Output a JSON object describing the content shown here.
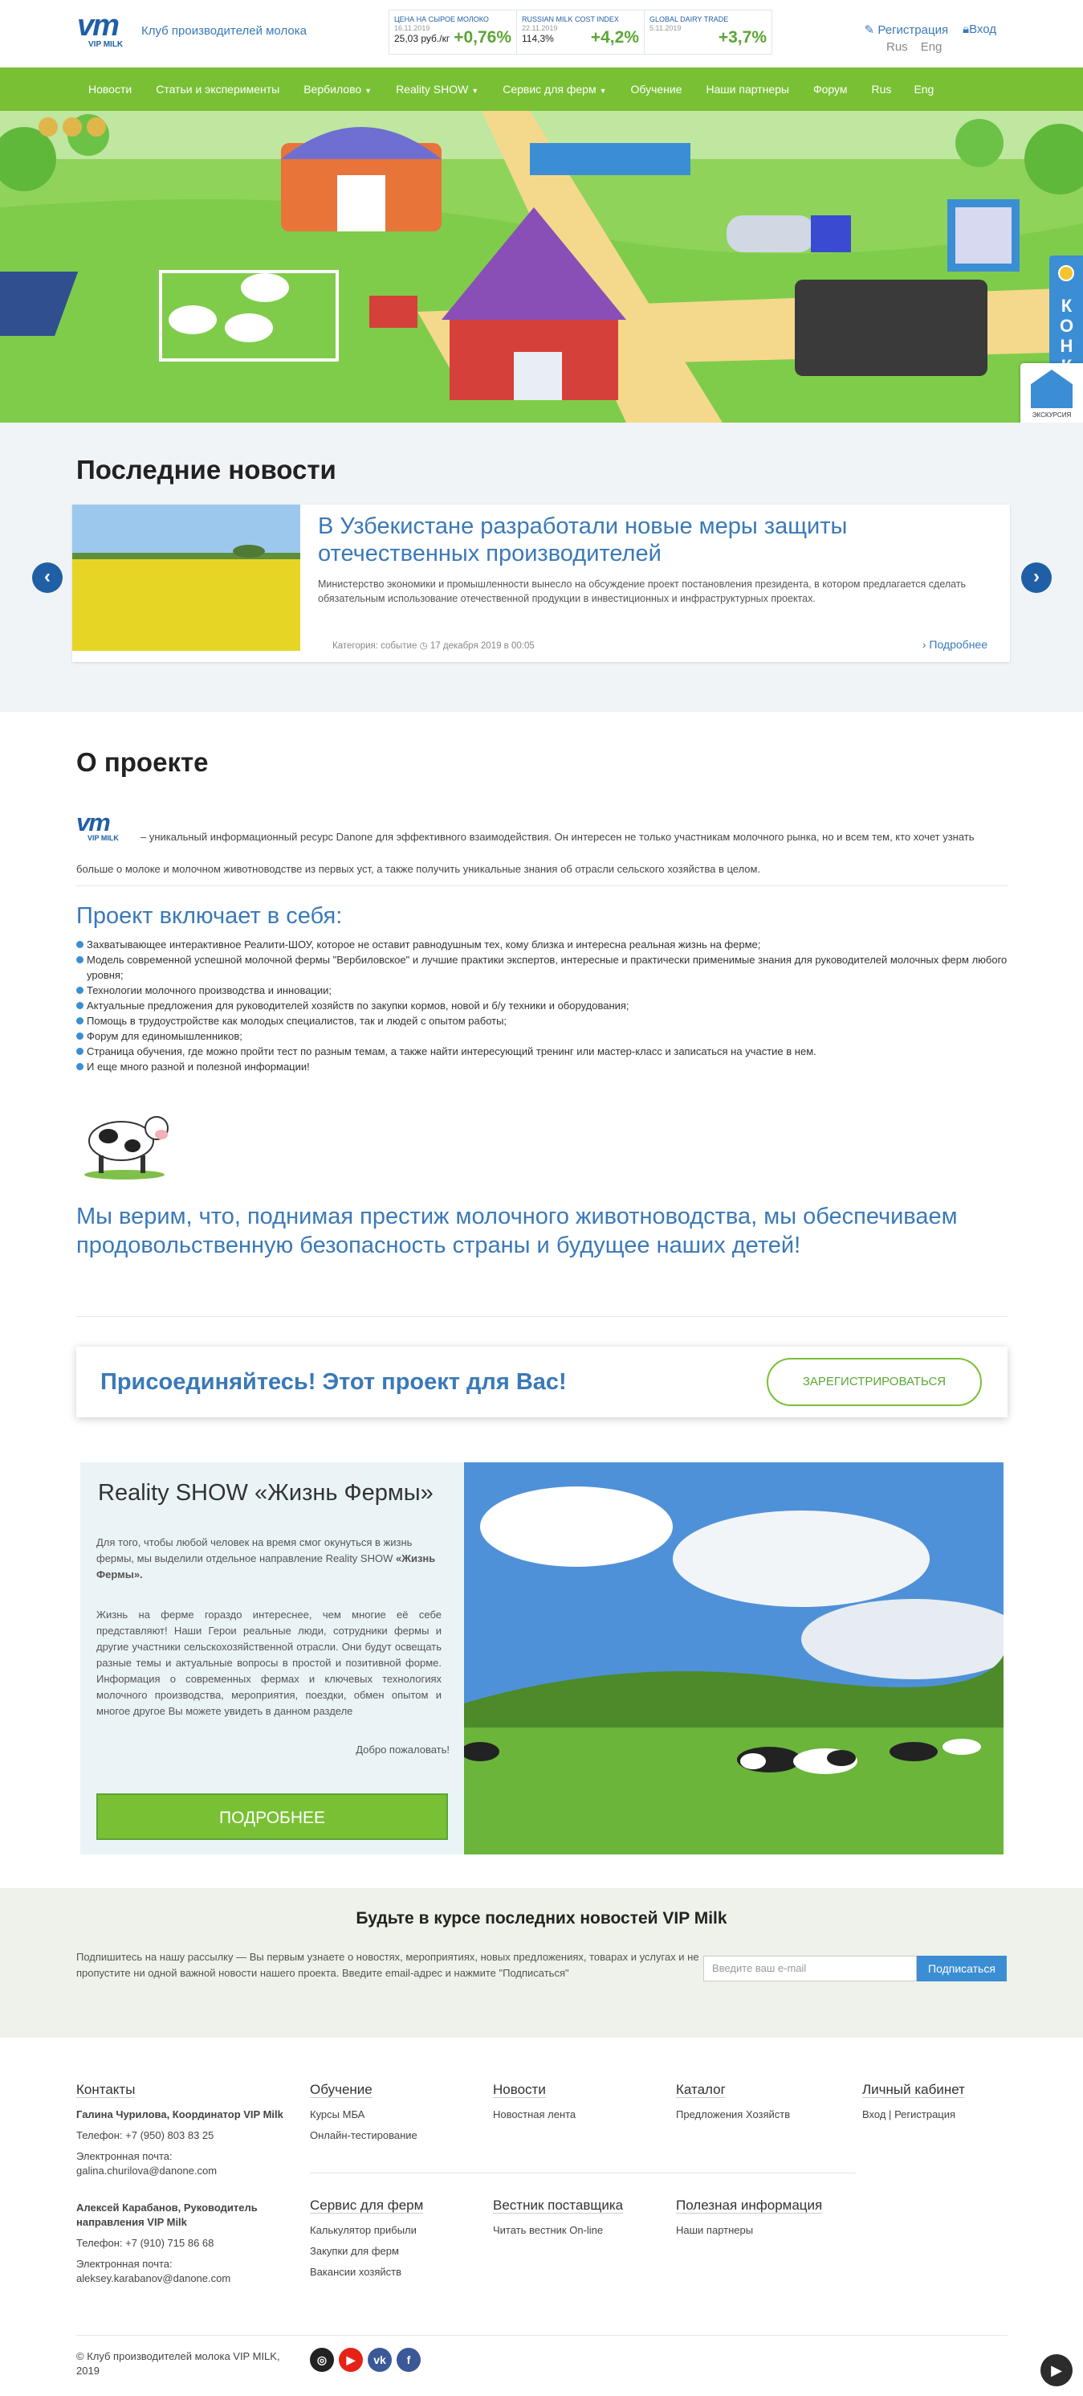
{
  "header": {
    "logo_text": "vm",
    "logo_sub": "VIP MILK",
    "club": "Клуб производителей молока",
    "tickers": [
      {
        "title": "ЦЕНА НА СЫРОЕ МОЛОКО",
        "date": "16.11.2019",
        "value": "25,03 руб./кг",
        "change": "+0,76%"
      },
      {
        "title": "RUSSIAN MILK COST INDEX",
        "date": "22.11.2019",
        "value": "114,3%",
        "change": "+4,2%"
      },
      {
        "title": "GLOBAL DAIRY TRADE",
        "date": "5.11.2019",
        "value": "",
        "change": "+3,7%"
      }
    ],
    "register": "Регистрация",
    "login": "Вход",
    "lang_ru": "Rus",
    "lang_en": "Eng"
  },
  "nav": [
    "Новости",
    "Статьи и эксперименты",
    "Вербилово",
    "Reality SHOW",
    "Сервис для ферм",
    "Обучение",
    "Наши партнеры",
    "Форум",
    "Rus",
    "Eng"
  ],
  "hero": {
    "contest": "КОНКУРС",
    "excursion": "ЭКСКУРСИЯ"
  },
  "news": {
    "heading": "Последние новости",
    "title": "В Узбекистане разработали новые меры защиты отечественных производителей",
    "text": "Министерство экономики и промышленности вынесло на обсуждение проект постановления президента, в котором предлагается сделать обязательным использование отечественной продукции в инвестиционных и инфраструктурных проектах.",
    "category": "Категория: событие",
    "date": "17 декабря 2019 в 00:05",
    "more": "Подробнее"
  },
  "about": {
    "heading": "О проекте",
    "intro": "– уникальный информационный ресурс Danone для эффективного взаимодействия. Он интересен не только участникам молочного рынка, но и всем тем, кто хочет узнать больше о молоке и молочном животноводстве из первых уст, а также получить уникальные знания об отрасли сельского хозяйства в целом.",
    "includes_title": "Проект включает в себя:",
    "includes": [
      "Захватывающее интерактивное Реалити-ШОУ, которое не оставит равнодушным тех, кому близка и интересна реальная жизнь на ферме;",
      "Модель современной успешной молочной фермы \"Вербиловское\" и лучшие практики экспертов, интересные и практически применимые знания для руководителей молочных ферм любого уровня;",
      "Технологии молочного производства и инновации;",
      "Актуальные предложения для руководителей хозяйств по закупки кормов, новой и б/у техники и оборудования;",
      "Помощь в трудоустройстве как молодых специалистов, так и людей с опытом работы;",
      "Форум для единомышленников;",
      "Страница обучения, где можно пройти тест по разным темам, а также найти интересующий тренинг или мастер-класс и записаться на участие в нем.",
      "И еще много разной и полезной информации!"
    ],
    "believe": "Мы верим, что, поднимая престиж молочного животноводства, мы обеспечиваем продовольственную безопасность страны и будущее наших детей!"
  },
  "join": {
    "text": "Присоединяйтесь! Этот проект для Вас!",
    "button": "ЗАРЕГИСТРИРОВАТЬСЯ"
  },
  "reality": {
    "title": "Reality SHOW «Жизнь Фермы»",
    "p1": "Для того, чтобы любой человек на время смог окунуться в жизнь фермы, мы выделили отдельное направление Reality SHOW",
    "p1_bold": "«Жизнь Фермы».",
    "p2": "Жизнь на ферме гораздо интереснее, чем многие её себе представляют! Наши Герои реальные люди, сотрудники фермы и другие участники сельскохозяйственной отрасли. Они будут освещать разные темы и актуальные вопросы в простой и позитивной форме. Информация о современных фермах и ключевых технологиях молочного производства, мероприятия, поездки, обмен опытом и многое другое Вы можете увидеть в данном разделе",
    "welcome": "Добро пожаловать!",
    "button": "ПОДРОБНЕЕ"
  },
  "subscribe": {
    "title": "Будьте в курсе последних новостей VIP Milk",
    "text": "Подпишитесь на нашу рассылку — Вы первым узнаете о новостях, мероприятиях, новых предложениях, товарах и услугах и не пропустите ни одной важной новости нашего проекта. Введите email-адрес и нажмите \"Подписаться\"",
    "placeholder": "Введите ваш e-mail",
    "button": "Подписаться"
  },
  "footer": {
    "contacts_title": "Контакты",
    "c1_name": "Галина Чурилова, Координатор VIP Milk",
    "c1_phone": "Телефон: +7 (950) 803 83 25",
    "c1_email_label": "Электронная почта:",
    "c1_email": "galina.churilova@danone.com",
    "c2_name": "Алексей Карабанов, Руководитель направления VIP Milk",
    "c2_phone": "Телефон: +7 (910) 715 86 68",
    "c2_email_label": "Электронная почта:",
    "c2_email": "aleksey.karabanov@danone.com",
    "learning_title": "Обучение",
    "learning": [
      "Курсы МБА",
      "Онлайн-тестирование"
    ],
    "news_title": "Новости",
    "news": [
      "Новостная лента"
    ],
    "catalog_title": "Каталог",
    "catalog": [
      "Предложения Хозяйств"
    ],
    "cabinet_title": "Личный кабинет",
    "cabinet_login": "Вход",
    "cabinet_sep": "|",
    "cabinet_reg": "Регистрация",
    "service_title": "Сервис для ферм",
    "service": [
      "Калькулятор прибыли",
      "Закупки для ферм",
      "Вакансии хозяйств"
    ],
    "vestnik_title": "Вестник поставщика",
    "vestnik": [
      "Читать вестник On-line"
    ],
    "useful_title": "Полезная информация",
    "useful": [
      "Наши партнеры"
    ],
    "copyright": "© Клуб производителей молока VIP MILK, 2019"
  },
  "colors": {
    "green": "#79c035",
    "blue": "#3a79b8",
    "dark_blue": "#1f5fa6"
  }
}
